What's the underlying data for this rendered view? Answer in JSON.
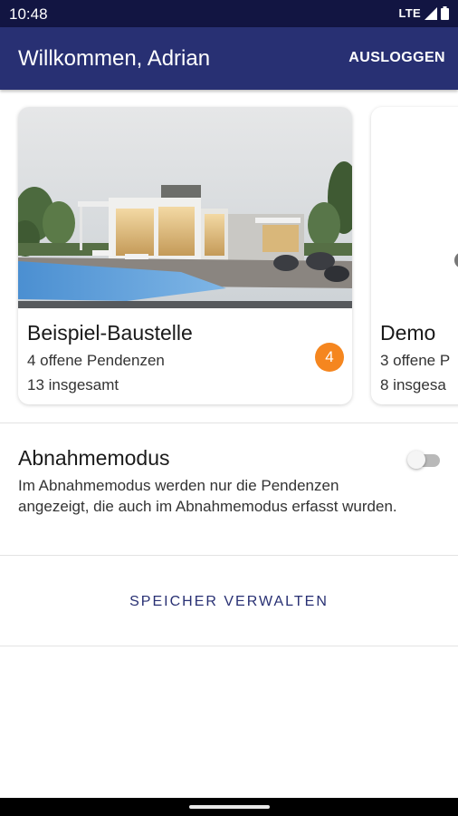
{
  "status_bar": {
    "time": "10:48",
    "network": "LTE",
    "icons": [
      "signal-icon",
      "battery-icon"
    ]
  },
  "app_bar": {
    "title": "Willkommen, Adrian",
    "logout_label": "AUSLOGGEN"
  },
  "projects": [
    {
      "title": "Beispiel-Baustelle",
      "open_items": "4 offene Pendenzen",
      "total": "13 insgesamt",
      "badge": "4",
      "image": "modern-house-with-pool"
    },
    {
      "title": "Demo",
      "open_items": "3 offene P",
      "total": "8 insgesa"
    }
  ],
  "acceptance_mode": {
    "title": "Abnahmemodus",
    "description": "Im Abnahmemodus werden nur die Pendenzen angezeigt, die auch im Abnahmemodus erfasst wurden.",
    "enabled": false
  },
  "storage_button": {
    "label": "SPEICHER VERWALTEN"
  },
  "colors": {
    "status_bar": "#121542",
    "app_bar": "#283073",
    "badge": "#f5861f",
    "accent_text": "#283073"
  }
}
